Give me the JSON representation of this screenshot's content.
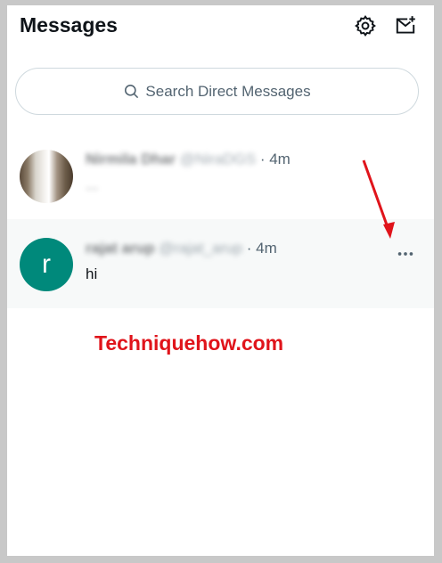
{
  "header": {
    "title": "Messages",
    "icons": [
      "gear-icon",
      "compose-message-icon"
    ]
  },
  "search": {
    "placeholder": "Search Direct Messages"
  },
  "conversations": [
    {
      "name": "Nirmila Dhar",
      "handle": "@NiraDGS",
      "time": "· 4m",
      "preview": "..."
    },
    {
      "name": "rajat arup",
      "handle": "@rajat_arup",
      "time": "· 4m",
      "preview": "hi",
      "avatar_letter": "r",
      "avatar_color": "#00897b"
    }
  ],
  "watermark": "Techniquehow.com",
  "colors": {
    "text_primary": "#0f1419",
    "text_secondary": "#536471",
    "hover_bg": "#f7f9f9",
    "annotation_red": "#e0141b"
  }
}
